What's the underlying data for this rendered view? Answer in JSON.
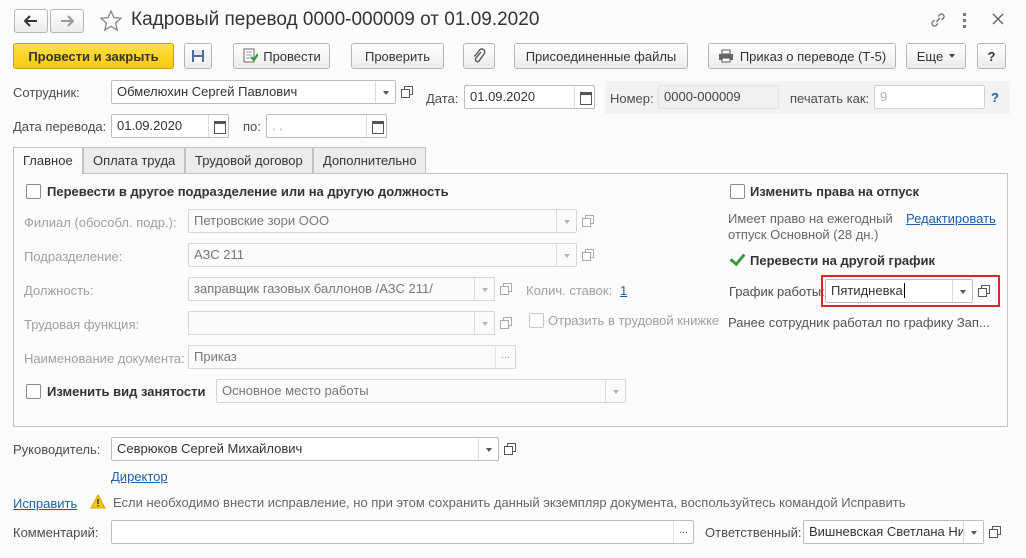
{
  "window": {
    "title": "Кадровый перевод 0000-000009 от 01.09.2020",
    "back_icon": "arrow-left-icon",
    "forward_icon": "arrow-right-icon",
    "star_icon": "star-icon",
    "link_icon": "link-icon",
    "menu_icon": "more-vertical-icon",
    "close_icon": "close-icon"
  },
  "toolbar": {
    "post_close": "Провести и закрыть",
    "save_icon": "save-icon",
    "post": "Провести",
    "check": "Проверить",
    "attach_icon": "paperclip-icon",
    "attached_files": "Присоединенные файлы",
    "print_order": "Приказ о переводе (Т-5)",
    "more": "Еще",
    "help": "?"
  },
  "header": {
    "employee_label": "Сотрудник:",
    "employee_value": "Обмелюхин Сергей Павлович",
    "date_label": "Дата:",
    "date_value": "01.09.2020",
    "number_label": "Номер:",
    "number_value": "0000-000009",
    "print_as_label": "печатать как:",
    "print_as_value": "9",
    "help_q": "?",
    "transfer_date_label": "Дата перевода:",
    "transfer_date_value": "01.09.2020",
    "to_label": "по:",
    "to_value": " .  ."
  },
  "tabs": [
    {
      "label": "Главное",
      "active": true
    },
    {
      "label": "Оплата труда",
      "active": false
    },
    {
      "label": "Трудовой договор",
      "active": false
    },
    {
      "label": "Дополнительно",
      "active": false
    }
  ],
  "main": {
    "transfer_dept_checkbox": "Перевести в другое подразделение или на другую должность",
    "branch_label": "Филиал (обособл. подр.):",
    "branch_value": "Петровские зори ООО",
    "division_label": "Подразделение:",
    "division_value": "АЗС 211",
    "position_label": "Должность:",
    "position_value": "заправщик газовых баллонов /АЗС 211/",
    "rates_label": "Колич. ставок:",
    "rates_value": "1",
    "labor_function_label": "Трудовая функция:",
    "labor_function_value": "",
    "workbook_checkbox": "Отразить в трудовой книжке",
    "doc_name_label": "Наименование документа:",
    "doc_name_value": "Приказ",
    "employment_type_checkbox": "Изменить вид занятости",
    "employment_type_value": "Основное место работы"
  },
  "right_panel": {
    "vacation_rights_checkbox": "Изменить права на отпуск",
    "vacation_info_line1": "Имеет право на ежегодный",
    "vacation_info_line2": "отпуск Основной (28 дн.)",
    "edit_link": "Редактировать",
    "schedule_checkbox": "Перевести на другой график",
    "schedule_label": "График работы:",
    "schedule_value": "Пятидневка",
    "previous_schedule": "Ранее сотрудник работал по графику Зап...",
    "highlight_color": "#d9262c"
  },
  "footer": {
    "manager_label": "Руководитель:",
    "manager_value": "Севрюков Сергей Михайлович",
    "manager_position": "Директор",
    "fix_link": "Исправить",
    "warning_icon": "warning-icon",
    "warning_text": "Если необходимо внести исправление, но при этом сохранить данный экземпляр документа, воспользуйтесь командой Исправить",
    "comment_label": "Комментарий:",
    "comment_value": "",
    "responsible_label": "Ответственный:",
    "responsible_value": "Вишневская Светлана Ни"
  }
}
